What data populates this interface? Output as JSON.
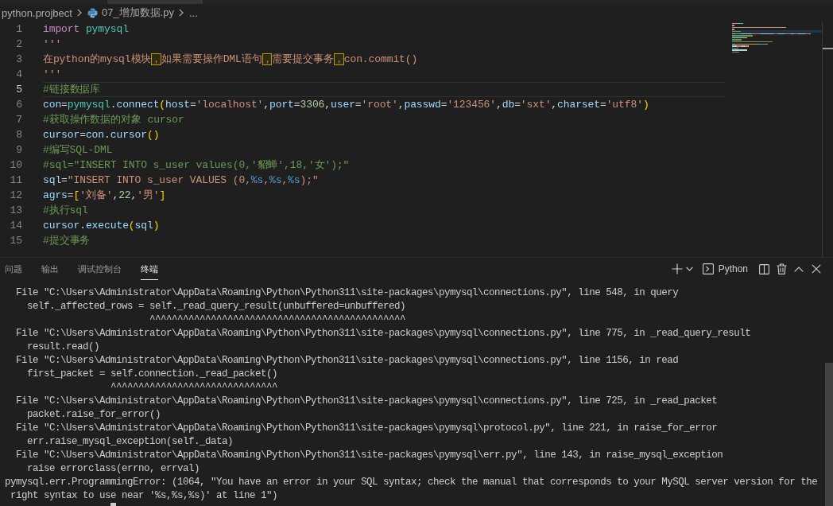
{
  "breadcrumb": [
    {
      "label": "python.projbect",
      "kind": "folder"
    },
    {
      "label": "07_增加数据.py",
      "kind": "file"
    },
    {
      "label": "...",
      "kind": "more"
    }
  ],
  "editor": {
    "lines": [
      {
        "number": "1",
        "current": false,
        "tokens": [
          {
            "kind": "keyword",
            "text": "import "
          },
          {
            "kind": "module",
            "text": "pymysql"
          }
        ]
      },
      {
        "number": "2",
        "current": false,
        "tokens": [
          {
            "kind": "string",
            "text": "'''"
          }
        ]
      },
      {
        "number": "3",
        "current": false,
        "tokens": [
          {
            "kind": "string",
            "text": "在python的mysql模块"
          },
          {
            "kind": "flagged",
            "text": "，"
          },
          {
            "kind": "string",
            "text": "如果需要操作DML语句"
          },
          {
            "kind": "flagged",
            "text": "，"
          },
          {
            "kind": "string",
            "text": "需要提交事务"
          },
          {
            "kind": "flagged",
            "text": "，"
          },
          {
            "kind": "string",
            "text": "con.commit()"
          }
        ]
      },
      {
        "number": "4",
        "current": false,
        "tokens": [
          {
            "kind": "string",
            "text": "'''"
          }
        ]
      },
      {
        "number": "5",
        "current": true,
        "tokens": [
          {
            "kind": "comment",
            "text": "#链接数据库"
          }
        ]
      },
      {
        "number": "6",
        "current": false,
        "tokens": [
          {
            "kind": "variable",
            "text": "con"
          },
          {
            "kind": "plain",
            "text": "="
          },
          {
            "kind": "module",
            "text": "pymysql"
          },
          {
            "kind": "plain",
            "text": "."
          },
          {
            "kind": "variable",
            "text": "connect"
          },
          {
            "kind": "bracket",
            "text": "("
          },
          {
            "kind": "variable",
            "text": "host"
          },
          {
            "kind": "plain",
            "text": "="
          },
          {
            "kind": "string",
            "text": "'localhost'"
          },
          {
            "kind": "plain",
            "text": ","
          },
          {
            "kind": "variable",
            "text": "port"
          },
          {
            "kind": "plain",
            "text": "="
          },
          {
            "kind": "number",
            "text": "3306"
          },
          {
            "kind": "plain",
            "text": ","
          },
          {
            "kind": "variable",
            "text": "user"
          },
          {
            "kind": "plain",
            "text": "="
          },
          {
            "kind": "string",
            "text": "'root'"
          },
          {
            "kind": "plain",
            "text": ","
          },
          {
            "kind": "variable",
            "text": "passwd"
          },
          {
            "kind": "plain",
            "text": "="
          },
          {
            "kind": "string",
            "text": "'123456'"
          },
          {
            "kind": "plain",
            "text": ","
          },
          {
            "kind": "variable",
            "text": "db"
          },
          {
            "kind": "plain",
            "text": "="
          },
          {
            "kind": "string",
            "text": "'sxt'"
          },
          {
            "kind": "plain",
            "text": ","
          },
          {
            "kind": "variable",
            "text": "charset"
          },
          {
            "kind": "plain",
            "text": "="
          },
          {
            "kind": "string",
            "text": "'utf8'"
          },
          {
            "kind": "bracket",
            "text": ")"
          }
        ]
      },
      {
        "number": "7",
        "current": false,
        "tokens": [
          {
            "kind": "comment",
            "text": "#获取操作数据的对象 cursor"
          }
        ]
      },
      {
        "number": "8",
        "current": false,
        "tokens": [
          {
            "kind": "variable",
            "text": "cursor"
          },
          {
            "kind": "plain",
            "text": "="
          },
          {
            "kind": "variable",
            "text": "con"
          },
          {
            "kind": "plain",
            "text": "."
          },
          {
            "kind": "variable",
            "text": "cursor"
          },
          {
            "kind": "bracket",
            "text": "()"
          }
        ]
      },
      {
        "number": "9",
        "current": false,
        "tokens": [
          {
            "kind": "comment",
            "text": "#编写SQL-DML"
          }
        ]
      },
      {
        "number": "10",
        "current": false,
        "tokens": [
          {
            "kind": "comment",
            "text": "#sql=\"INSERT INTO s_user values(0,'貂蝉',18,'女');\""
          }
        ]
      },
      {
        "number": "11",
        "current": false,
        "tokens": [
          {
            "kind": "variable",
            "text": "sql"
          },
          {
            "kind": "plain",
            "text": "="
          },
          {
            "kind": "string",
            "text": "\"INSERT INTO s_user VALUES (0,"
          },
          {
            "kind": "placeholder",
            "text": "%s"
          },
          {
            "kind": "string",
            "text": ","
          },
          {
            "kind": "placeholder",
            "text": "%s"
          },
          {
            "kind": "string",
            "text": ","
          },
          {
            "kind": "placeholder",
            "text": "%s"
          },
          {
            "kind": "string",
            "text": ");\""
          }
        ]
      },
      {
        "number": "12",
        "current": false,
        "tokens": [
          {
            "kind": "variable",
            "text": "agrs"
          },
          {
            "kind": "plain",
            "text": "="
          },
          {
            "kind": "bracket",
            "text": "["
          },
          {
            "kind": "string",
            "text": "'刘备'"
          },
          {
            "kind": "plain",
            "text": ","
          },
          {
            "kind": "number",
            "text": "22"
          },
          {
            "kind": "plain",
            "text": ","
          },
          {
            "kind": "string",
            "text": "'男'"
          },
          {
            "kind": "bracket",
            "text": "]"
          }
        ]
      },
      {
        "number": "13",
        "current": false,
        "tokens": [
          {
            "kind": "comment",
            "text": "#执行sql"
          }
        ]
      },
      {
        "number": "14",
        "current": false,
        "tokens": [
          {
            "kind": "variable",
            "text": "cursor"
          },
          {
            "kind": "plain",
            "text": "."
          },
          {
            "kind": "variable",
            "text": "execute"
          },
          {
            "kind": "bracket",
            "text": "("
          },
          {
            "kind": "variable",
            "text": "sql"
          },
          {
            "kind": "bracket",
            "text": ")"
          }
        ]
      },
      {
        "number": "15",
        "current": false,
        "tokens": [
          {
            "kind": "comment",
            "text": "#提交事务"
          }
        ]
      }
    ]
  },
  "panel": {
    "tabs": [
      {
        "label": "问题",
        "selected": false
      },
      {
        "label": "输出",
        "selected": false
      },
      {
        "label": "调试控制台",
        "selected": false
      },
      {
        "label": "终端",
        "selected": true
      }
    ],
    "profile": "Python"
  },
  "terminal": {
    "lines": [
      "  File \"C:\\Users\\Administrator\\AppData\\Roaming\\Python\\Python311\\site-packages\\pymysql\\connections.py\", line 548, in query",
      "    self._affected_rows = self._read_query_result(unbuffered=unbuffered)",
      "                          ^^^^^^^^^^^^^^^^^^^^^^^^^^^^^^^^^^^^^^^^^^^^^^",
      "  File \"C:\\Users\\Administrator\\AppData\\Roaming\\Python\\Python311\\site-packages\\pymysql\\connections.py\", line 775, in _read_query_result",
      "    result.read()",
      "  File \"C:\\Users\\Administrator\\AppData\\Roaming\\Python\\Python311\\site-packages\\pymysql\\connections.py\", line 1156, in read",
      "    first_packet = self.connection._read_packet()",
      "                   ^^^^^^^^^^^^^^^^^^^^^^^^^^^^^^",
      "  File \"C:\\Users\\Administrator\\AppData\\Roaming\\Python\\Python311\\site-packages\\pymysql\\connections.py\", line 725, in _read_packet",
      "    packet.raise_for_error()",
      "  File \"C:\\Users\\Administrator\\AppData\\Roaming\\Python\\Python311\\site-packages\\pymysql\\protocol.py\", line 221, in raise_for_error",
      "    err.raise_mysql_exception(self._data)",
      "  File \"C:\\Users\\Administrator\\AppData\\Roaming\\Python\\Python311\\site-packages\\pymysql\\err.py\", line 143, in raise_mysql_exception",
      "    raise errorclass(errno, errval)",
      "pymysql.err.ProgrammingError: (1064, \"You have an error in your SQL syntax; check the manual that corresponds to your MySQL server version for the",
      " right syntax to use near '%s,%s,%s)' at line 1\")"
    ]
  }
}
